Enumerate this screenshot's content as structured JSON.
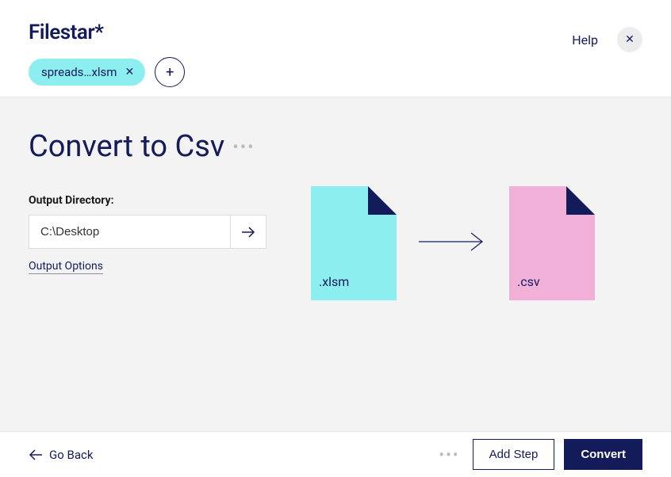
{
  "brand": "Filestar*",
  "header": {
    "help_label": "Help"
  },
  "file_chip": {
    "name": "spreads…xlsm"
  },
  "page": {
    "title": "Convert to Csv"
  },
  "output": {
    "label": "Output Directory:",
    "value": "C:\\Desktop",
    "options_link": "Output Options"
  },
  "conversion": {
    "from_ext": ".xlsm",
    "to_ext": ".csv"
  },
  "footer": {
    "go_back": "Go Back",
    "add_step": "Add Step",
    "convert": "Convert"
  }
}
